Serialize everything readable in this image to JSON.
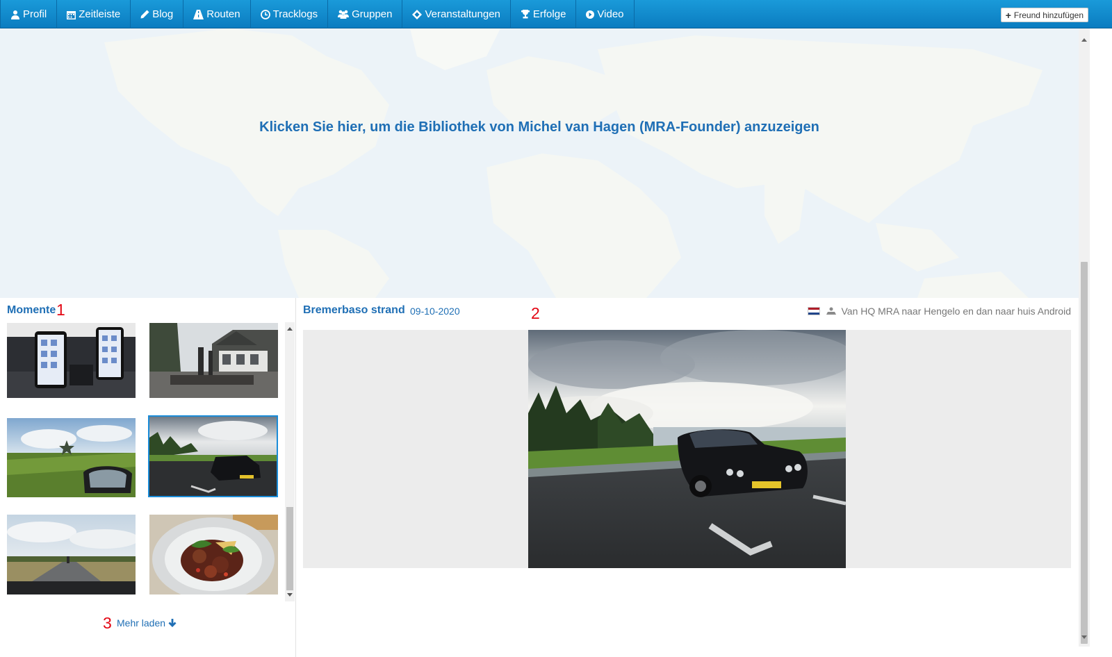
{
  "nav": {
    "tabs": [
      {
        "label": "Profil",
        "icon": "user-icon"
      },
      {
        "label": "Zeitleiste",
        "icon": "calendar-icon"
      },
      {
        "label": "Blog",
        "icon": "pencil-icon"
      },
      {
        "label": "Routen",
        "icon": "road-icon"
      },
      {
        "label": "Tracklogs",
        "icon": "clock-icon"
      },
      {
        "label": "Gruppen",
        "icon": "group-icon"
      },
      {
        "label": "Veranstaltungen",
        "icon": "ticket-icon"
      },
      {
        "label": "Erfolge",
        "icon": "trophy-icon"
      },
      {
        "label": "Video",
        "icon": "play-icon"
      }
    ],
    "add_friend_label": "Freund hinzufügen"
  },
  "map": {
    "link_text": "Klicken Sie hier, um die Bibliothek von Michel van Hagen (MRA-Founder) anzuzeigen"
  },
  "moments": {
    "title": "Momente",
    "load_more_label": "Mehr laden",
    "selected_index": 3
  },
  "detail": {
    "title": "Bremerbaso strand",
    "date": "09-10-2020",
    "route": "Van HQ MRA naar Hengelo en dan naar huis Android"
  },
  "annotations": [
    "1",
    "2",
    "3"
  ],
  "colors": {
    "nav_bg": "#0b7cc0",
    "link": "#1f6fb5",
    "annotation": "#e30613",
    "selection": "#1a8cd8"
  }
}
